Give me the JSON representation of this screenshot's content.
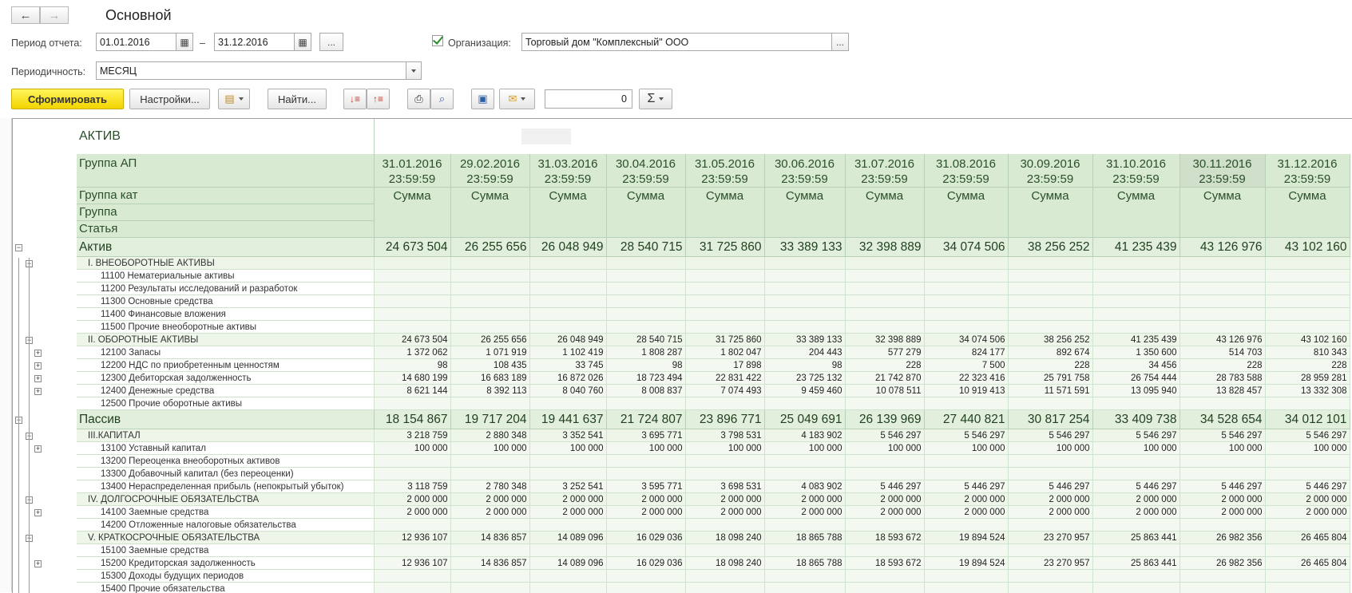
{
  "window": {
    "title": "Основной"
  },
  "nav": {
    "back": "←",
    "forward": "→"
  },
  "params": {
    "period_label": "Период отчета:",
    "date_from": "01.01.2016",
    "dash": "–",
    "date_to": "31.12.2016",
    "ellipsis": "...",
    "org_label": "Организация:",
    "org_value": "Торговый дом \"Комплексный\" ООО",
    "periodicity_label": "Периодичность:",
    "periodicity_value": "МЕСЯЦ"
  },
  "toolbar": {
    "generate": "Сформировать",
    "settings": "Настройки...",
    "find": "Найти...",
    "counter": "0",
    "sigma": "Σ"
  },
  "report": {
    "aktiv_title": "АКТИВ",
    "h_group_ap": "Группа АП",
    "h_group_kat": "Группа кат",
    "h_group": "Группа",
    "h_statya": "Статья",
    "sum_label": "Сумма",
    "dates": [
      [
        "31.01.2016",
        "23:59:59"
      ],
      [
        "29.02.2016",
        "23:59:59"
      ],
      [
        "31.03.2016",
        "23:59:59"
      ],
      [
        "30.04.2016",
        "23:59:59"
      ],
      [
        "31.05.2016",
        "23:59:59"
      ],
      [
        "30.06.2016",
        "23:59:59"
      ],
      [
        "31.07.2016",
        "23:59:59"
      ],
      [
        "31.08.2016",
        "23:59:59"
      ],
      [
        "30.09.2016",
        "23:59:59"
      ],
      [
        "31.10.2016",
        "23:59:59"
      ],
      [
        "30.11.2016",
        "23:59:59"
      ],
      [
        "31.12.2016",
        "23:59:59"
      ]
    ],
    "rows": [
      {
        "type": "group",
        "name": "Актив",
        "values": [
          "24 673 504",
          "26 255 656",
          "26 048 949",
          "28 540 715",
          "31 725 860",
          "33 389 133",
          "32 398 889",
          "34 074 506",
          "38 256 252",
          "41 235 439",
          "43 126 976",
          "43 102 160"
        ]
      },
      {
        "type": "sub",
        "name": "I. ВНЕОБОРОТНЫЕ АКТИВЫ",
        "values": [
          "",
          "",
          "",
          "",
          "",
          "",
          "",
          "",
          "",
          "",
          "",
          ""
        ]
      },
      {
        "type": "item",
        "name": "11100 Нематериальные активы",
        "values": [
          "",
          "",
          "",
          "",
          "",
          "",
          "",
          "",
          "",
          "",
          "",
          ""
        ]
      },
      {
        "type": "item",
        "name": "11200 Результаты исследований и разработок",
        "values": [
          "",
          "",
          "",
          "",
          "",
          "",
          "",
          "",
          "",
          "",
          "",
          ""
        ]
      },
      {
        "type": "item",
        "name": "11300 Основные средства",
        "values": [
          "",
          "",
          "",
          "",
          "",
          "",
          "",
          "",
          "",
          "",
          "",
          ""
        ]
      },
      {
        "type": "item",
        "name": "11400 Финансовые вложения",
        "values": [
          "",
          "",
          "",
          "",
          "",
          "",
          "",
          "",
          "",
          "",
          "",
          ""
        ]
      },
      {
        "type": "item",
        "name": "11500 Прочие внеоборотные активы",
        "values": [
          "",
          "",
          "",
          "",
          "",
          "",
          "",
          "",
          "",
          "",
          "",
          ""
        ]
      },
      {
        "type": "sub",
        "name": "II. ОБОРОТНЫЕ АКТИВЫ",
        "values": [
          "24 673 504",
          "26 255 656",
          "26 048 949",
          "28 540 715",
          "31 725 860",
          "33 389 133",
          "32 398 889",
          "34 074 506",
          "38 256 252",
          "41 235 439",
          "43 126 976",
          "43 102 160"
        ]
      },
      {
        "type": "item",
        "name": "12100 Запасы",
        "values": [
          "1 372 062",
          "1 071 919",
          "1 102 419",
          "1 808 287",
          "1 802 047",
          "204 443",
          "577 279",
          "824 177",
          "892 674",
          "1 350 600",
          "514 703",
          "810 343"
        ]
      },
      {
        "type": "item",
        "name": "12200 НДС по приобретенным  ценностям",
        "values": [
          "98",
          "108 435",
          "33 745",
          "98",
          "17 898",
          "98",
          "228",
          "7 500",
          "228",
          "34 456",
          "228",
          "228"
        ]
      },
      {
        "type": "item",
        "name": "12300 Дебиторская задолженность",
        "values": [
          "14 680 199",
          "16 683 189",
          "16 872 026",
          "18 723 494",
          "22 831 422",
          "23 725 132",
          "21 742 870",
          "22 323 416",
          "25 791 758",
          "26 754 444",
          "28 783 588",
          "28 959 281"
        ]
      },
      {
        "type": "item",
        "name": "12400 Денежные средства",
        "values": [
          "8 621 144",
          "8 392 113",
          "8 040 760",
          "8 008 837",
          "7 074 493",
          "9 459 460",
          "10 078 511",
          "10 919 413",
          "11 571 591",
          "13 095 940",
          "13 828 457",
          "13 332 308"
        ]
      },
      {
        "type": "item",
        "name": "12500 Прочие оборотные активы",
        "values": [
          "",
          "",
          "",
          "",
          "",
          "",
          "",
          "",
          "",
          "",
          "",
          ""
        ]
      },
      {
        "type": "group",
        "name": "Пассив",
        "values": [
          "18 154 867",
          "19 717 204",
          "19 441 637",
          "21 724 807",
          "23 896 771",
          "25 049 691",
          "26 139 969",
          "27 440 821",
          "30 817 254",
          "33 409 738",
          "34 528 654",
          "34 012 101"
        ]
      },
      {
        "type": "sub",
        "name": "III.КАПИТАЛ",
        "values": [
          "3 218 759",
          "2 880 348",
          "3 352 541",
          "3 695 771",
          "3 798 531",
          "4 183 902",
          "5 546 297",
          "5 546 297",
          "5 546 297",
          "5 546 297",
          "5 546 297",
          "5 546 297"
        ]
      },
      {
        "type": "item",
        "name": "13100 Уставный капитал",
        "values": [
          "100 000",
          "100 000",
          "100 000",
          "100 000",
          "100 000",
          "100 000",
          "100 000",
          "100 000",
          "100 000",
          "100 000",
          "100 000",
          "100 000"
        ]
      },
      {
        "type": "item",
        "name": "13200 Переоценка внеоборотных активов",
        "values": [
          "",
          "",
          "",
          "",
          "",
          "",
          "",
          "",
          "",
          "",
          "",
          ""
        ]
      },
      {
        "type": "item",
        "name": "13300 Добавочный капитал (без переоценки)",
        "values": [
          "",
          "",
          "",
          "",
          "",
          "",
          "",
          "",
          "",
          "",
          "",
          ""
        ]
      },
      {
        "type": "item",
        "name": "13400 Нераспределенная прибыль (непокрытый убыток)",
        "values": [
          "3 118 759",
          "2 780 348",
          "3 252 541",
          "3 595 771",
          "3 698 531",
          "4 083 902",
          "5 446 297",
          "5 446 297",
          "5 446 297",
          "5 446 297",
          "5 446 297",
          "5 446 297"
        ]
      },
      {
        "type": "sub",
        "name": "IV. ДОЛГОСРОЧНЫЕ ОБЯЗАТЕЛЬСТВА",
        "values": [
          "2 000 000",
          "2 000 000",
          "2 000 000",
          "2 000 000",
          "2 000 000",
          "2 000 000",
          "2 000 000",
          "2 000 000",
          "2 000 000",
          "2 000 000",
          "2 000 000",
          "2 000 000"
        ]
      },
      {
        "type": "item",
        "name": "14100 Заемные средства",
        "values": [
          "2 000 000",
          "2 000 000",
          "2 000 000",
          "2 000 000",
          "2 000 000",
          "2 000 000",
          "2 000 000",
          "2 000 000",
          "2 000 000",
          "2 000 000",
          "2 000 000",
          "2 000 000"
        ]
      },
      {
        "type": "item",
        "name": "14200 Отложенные налоговые обязательства",
        "values": [
          "",
          "",
          "",
          "",
          "",
          "",
          "",
          "",
          "",
          "",
          "",
          ""
        ]
      },
      {
        "type": "sub",
        "name": "V. КРАТКОСРОЧНЫЕ ОБЯЗАТЕЛЬСТВА",
        "values": [
          "12 936 107",
          "14 836 857",
          "14 089 096",
          "16 029 036",
          "18 098 240",
          "18 865 788",
          "18 593 672",
          "19 894 524",
          "23 270 957",
          "25 863 441",
          "26 982 356",
          "26 465 804"
        ]
      },
      {
        "type": "item",
        "name": "15100 Заемные средства",
        "values": [
          "",
          "",
          "",
          "",
          "",
          "",
          "",
          "",
          "",
          "",
          "",
          ""
        ]
      },
      {
        "type": "item",
        "name": "15200 Кредиторская задолженность",
        "values": [
          "12 936 107",
          "14 836 857",
          "14 089 096",
          "16 029 036",
          "18 098 240",
          "18 865 788",
          "18 593 672",
          "19 894 524",
          "23 270 957",
          "25 863 441",
          "26 982 356",
          "26 465 804"
        ]
      },
      {
        "type": "item",
        "name": "15300 Доходы будущих периодов",
        "values": [
          "",
          "",
          "",
          "",
          "",
          "",
          "",
          "",
          "",
          "",
          "",
          ""
        ]
      },
      {
        "type": "item",
        "name": "15400 Прочие обязательства",
        "values": [
          "",
          "",
          "",
          "",
          "",
          "",
          "",
          "",
          "",
          "",
          "",
          ""
        ]
      }
    ]
  }
}
